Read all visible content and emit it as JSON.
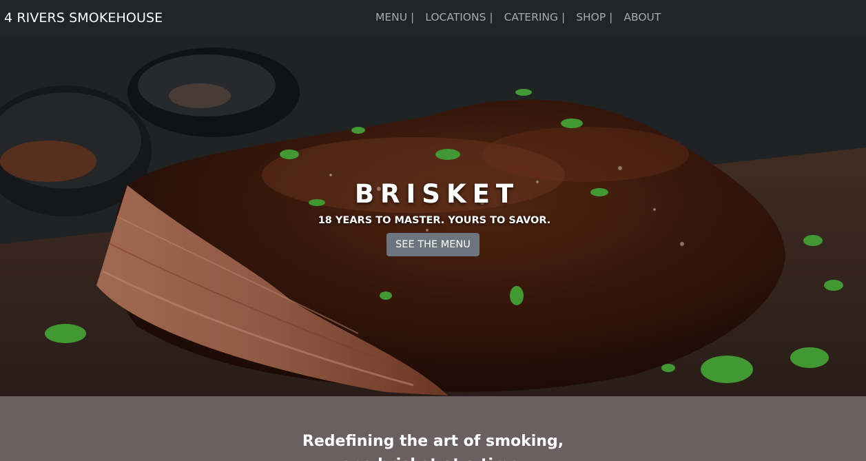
{
  "header": {
    "brand": "4 RIVERS SMOKEHOUSE",
    "nav": [
      {
        "label": "MENU |"
      },
      {
        "label": "LOCATIONS |"
      },
      {
        "label": "CATERING |"
      },
      {
        "label": "SHOP |"
      },
      {
        "label": "ABOUT"
      }
    ]
  },
  "hero": {
    "title": "BRISKET",
    "subtitle": "18 YEARS TO MASTER. YOURS TO SAVOR.",
    "button_label": "SEE THE MENU",
    "image_alt": "brisket-photo"
  },
  "intro": {
    "tagline": "Redefining the art of smoking,",
    "tagline_line2": "one brisket at a time."
  },
  "colors": {
    "navbar_bg": "#212429",
    "nav_link": "#a7abb0",
    "button_bg": "#6c757d",
    "section_bg": "#6b6061"
  }
}
